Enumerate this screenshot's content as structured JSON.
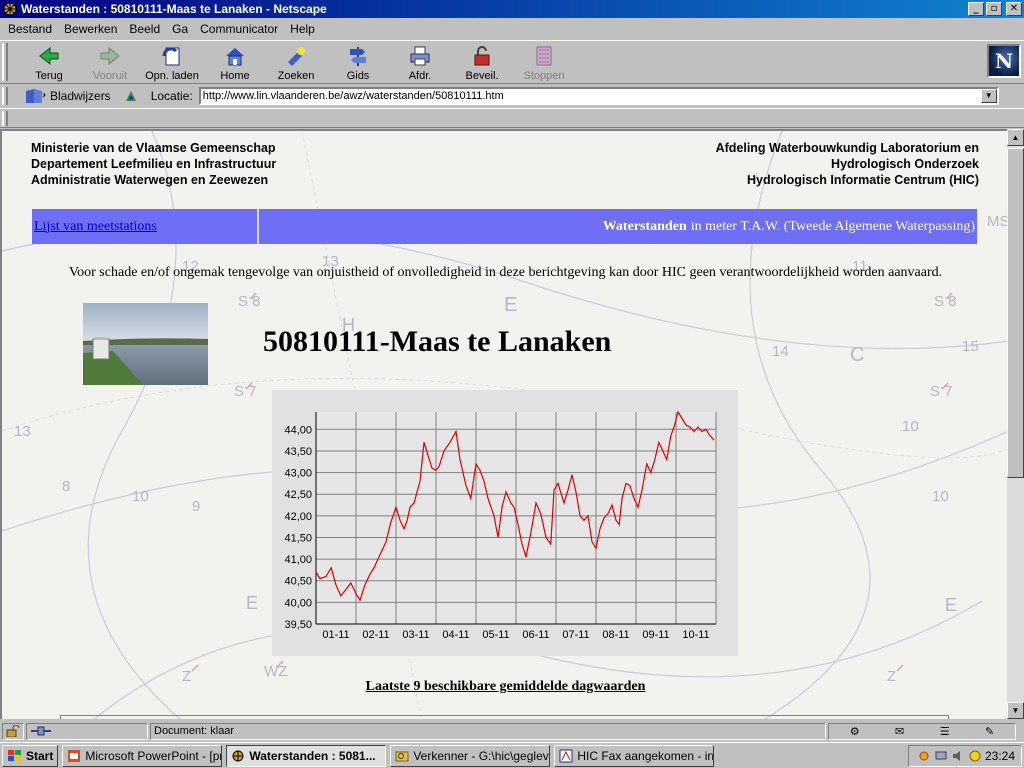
{
  "window": {
    "title": "Waterstanden : 50810111-Maas te Lanaken - Netscape"
  },
  "menu": [
    "Bestand",
    "Bewerken",
    "Beeld",
    "Ga",
    "Communicator",
    "Help"
  ],
  "toolbar": {
    "back": "Terug",
    "forward": "Vooruit",
    "reload": "Opn. laden",
    "home": "Home",
    "search": "Zoeken",
    "guide": "Gids",
    "print": "Afdr.",
    "security": "Beveil.",
    "stop": "Stoppen"
  },
  "location": {
    "bookmarks": "Bladwijzers",
    "label": "Locatie:",
    "url": "http://www.lin.vlaanderen.be/awz/waterstanden/50810111.htm"
  },
  "page": {
    "header_left": [
      "Ministerie van de Vlaamse Gemeenschap",
      "Departement Leefmilieu en Infrastructuur",
      "Administratie Waterwegen en Zeewezen"
    ],
    "header_right": [
      "Afdeling Waterbouwkundig Laboratorium en",
      "Hydrologisch Onderzoek",
      "Hydrologisch Informatie Centrum (HIC)"
    ],
    "stations_link": "Lijst van meetstations",
    "waterstanden_bold": "Waterstanden",
    "waterstanden_rest": "in meter T.A.W. (Tweede Algemene Waterpassing)",
    "disclaimer": "Voor schade en/of ongemak tengevolge van onjuistheid of onvolledigheid in deze berichtgeving kan door HIC geen verantwoordelijkheid worden aanvaard.",
    "station_title": "50810111-Maas te Lanaken",
    "caption": "Laatste 9 beschikbare gemiddelde dagwaarden"
  },
  "chart_data": {
    "type": "line",
    "title": "",
    "xlabel": "",
    "ylabel": "",
    "categories": [
      "01-11",
      "02-11",
      "03-11",
      "04-11",
      "05-11",
      "06-11",
      "07-11",
      "08-11",
      "09-11",
      "10-11"
    ],
    "yticks": [
      "39,50",
      "40,00",
      "40,50",
      "41,00",
      "41,50",
      "42,00",
      "42,50",
      "43,00",
      "43,50",
      "44,00"
    ],
    "ylim": [
      39.5,
      44.4
    ],
    "xlim": [
      0,
      10
    ],
    "grid": true,
    "line_color": "#e00000",
    "series": [
      {
        "x": [
          0.0,
          0.1,
          0.25,
          0.38,
          0.5,
          0.62,
          0.75,
          0.87,
          1.0,
          1.1,
          1.22,
          1.35,
          1.45,
          1.6,
          1.75,
          1.87,
          2.0,
          2.1,
          2.2,
          2.28,
          2.35,
          2.45,
          2.6,
          2.7,
          2.8,
          2.9,
          3.0,
          3.08,
          3.2,
          3.35,
          3.5,
          3.6,
          3.75,
          3.87,
          4.0,
          4.1,
          4.2,
          4.3,
          4.45,
          4.55,
          4.65,
          4.75,
          4.87,
          4.95,
          5.05,
          5.15,
          5.25,
          5.37,
          5.5,
          5.62,
          5.75,
          5.87,
          5.95,
          6.05,
          6.2,
          6.3,
          6.4,
          6.5,
          6.6,
          6.7,
          6.8,
          6.9,
          7.0,
          7.1,
          7.2,
          7.3,
          7.4,
          7.5,
          7.58,
          7.65,
          7.75,
          7.85,
          7.95,
          8.05,
          8.15,
          8.27,
          8.37,
          8.47,
          8.57,
          8.67,
          8.77,
          8.87,
          8.95,
          9.05,
          9.15,
          9.25,
          9.35,
          9.45,
          9.55,
          9.65,
          9.75,
          9.85,
          9.95
        ],
        "y": [
          40.7,
          40.55,
          40.6,
          40.8,
          40.4,
          40.15,
          40.3,
          40.45,
          40.2,
          40.05,
          40.4,
          40.65,
          40.8,
          41.1,
          41.4,
          41.85,
          42.2,
          41.9,
          41.7,
          41.9,
          42.2,
          42.3,
          42.8,
          43.7,
          43.4,
          43.1,
          43.05,
          43.15,
          43.5,
          43.7,
          43.95,
          43.3,
          42.7,
          42.4,
          43.2,
          43.05,
          42.8,
          42.4,
          42.0,
          41.5,
          42.2,
          42.55,
          42.3,
          42.2,
          41.8,
          41.35,
          41.05,
          41.6,
          42.3,
          42.05,
          41.5,
          41.35,
          42.6,
          42.75,
          42.3,
          42.6,
          42.95,
          42.55,
          42.0,
          41.9,
          42.0,
          41.4,
          41.25,
          41.7,
          41.95,
          42.05,
          42.25,
          41.9,
          41.8,
          42.4,
          42.75,
          42.7,
          42.4,
          42.2,
          42.6,
          43.2,
          43.0,
          43.3,
          43.7,
          43.5,
          43.3,
          43.85,
          44.05,
          44.4,
          44.25,
          44.1,
          44.05,
          43.95,
          44.05,
          43.95,
          44.0,
          43.85,
          43.75
        ]
      }
    ]
  },
  "statusbar": {
    "message": "Document: klaar"
  },
  "taskbar": {
    "start": "Start",
    "tasks": [
      "Microsoft PowerPoint - [pre...",
      "Waterstanden : 5081...",
      "Verkenner - G:\\hic\\geglev...",
      "HIC Fax aangekomen - inb..."
    ],
    "clock": "23:24"
  }
}
